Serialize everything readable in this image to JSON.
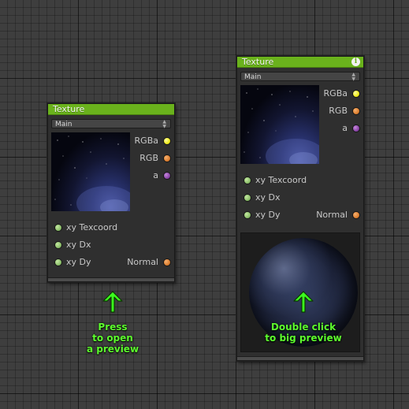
{
  "nodes": [
    {
      "id": "left",
      "title": "Texture",
      "dropdown": "Main",
      "outputs": [
        {
          "label": "RGBa",
          "color": "#eeea1a"
        },
        {
          "label": "RGB",
          "color": "#dd7f30"
        },
        {
          "label": "a",
          "color": "#8b44a8"
        }
      ],
      "inputs": [
        "xy Texcoord",
        "xy Dx",
        "xy Dy"
      ],
      "normal_output": "Normal"
    },
    {
      "id": "right",
      "title": "Texture",
      "info_icon": "i",
      "dropdown": "Main",
      "outputs": [
        {
          "label": "RGBa",
          "color": "#eeea1a"
        },
        {
          "label": "RGB",
          "color": "#dd7f30"
        },
        {
          "label": "a",
          "color": "#8b44a8"
        }
      ],
      "inputs": [
        "xy Texcoord",
        "xy Dx",
        "xy Dy"
      ],
      "normal_output": "Normal"
    }
  ],
  "captions": {
    "left": [
      "Press",
      "to open",
      "a preview"
    ],
    "right": [
      "Double click",
      "to big preview"
    ]
  },
  "colors": {
    "header": "#6ab21c",
    "caption": "#5dff2e",
    "arrow": "#3cff1e",
    "input_port": "#8dc06b"
  },
  "icons": {
    "info": "info-icon",
    "arrow": "arrow-up-icon",
    "dropdown": "chevron-up-down-icon"
  }
}
